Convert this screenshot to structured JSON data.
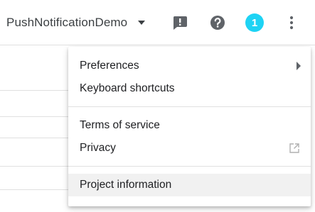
{
  "header": {
    "project_name": "PushNotificationDemo",
    "notification_count": "1",
    "icons": {
      "dropdown": "caret-down-icon",
      "feedback": "feedback-exclamation-icon",
      "help": "help-question-icon",
      "more": "more-vert-icon"
    }
  },
  "menu": {
    "items": [
      {
        "label": "Preferences",
        "trailing": "submenu-arrow-icon"
      },
      {
        "label": "Keyboard shortcuts"
      },
      {
        "label": "Terms of service"
      },
      {
        "label": "Privacy",
        "trailing": "external-link-icon"
      },
      {
        "label": "Project information",
        "highlighted": true
      }
    ]
  },
  "colors": {
    "badge": "#1ed3f4",
    "icon": "#5f6368",
    "text": "#202124",
    "highlight": "#f1f1f1"
  }
}
